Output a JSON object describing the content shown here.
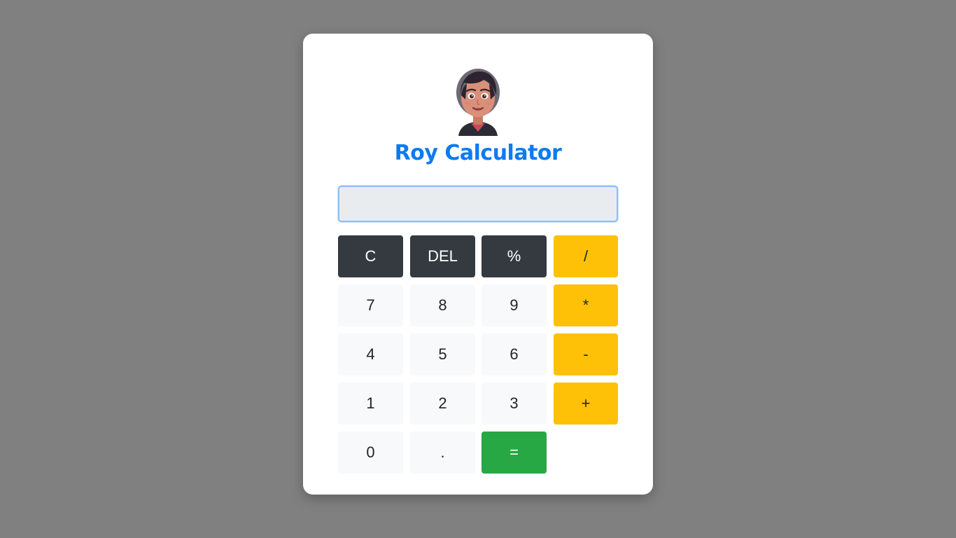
{
  "app": {
    "title": "Roy Calculator"
  },
  "display": {
    "value": "",
    "placeholder": ""
  },
  "keys": {
    "clear": "C",
    "delete": "DEL",
    "percent": "%",
    "divide": "/",
    "seven": "7",
    "eight": "8",
    "nine": "9",
    "multiply": "*",
    "four": "4",
    "five": "5",
    "six": "6",
    "minus": "-",
    "one": "1",
    "two": "2",
    "three": "3",
    "plus": "+",
    "zero": "0",
    "dot": ".",
    "equals": "="
  },
  "colors": {
    "title": "#0d7bf0",
    "function_key": "#343a40",
    "number_key": "#f8f9fa",
    "operator_key": "#ffc107",
    "equals_key": "#28a745",
    "page_background": "#808080"
  },
  "icons": {
    "avatar": "girl-avatar-icon"
  }
}
